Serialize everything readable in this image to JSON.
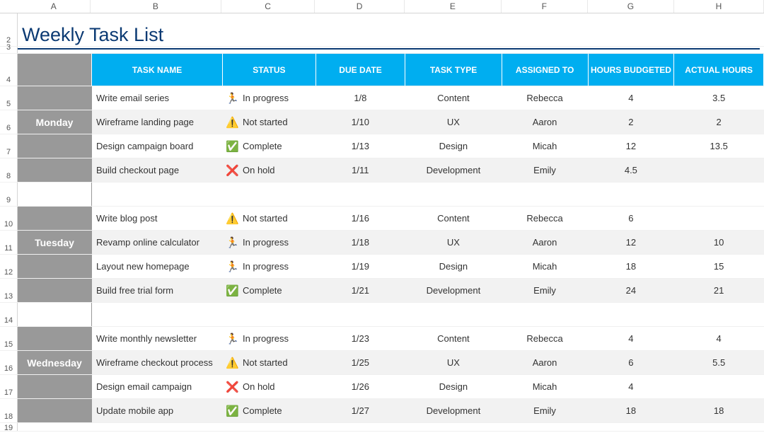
{
  "title": "Weekly Task List",
  "columns": [
    "A",
    "B",
    "C",
    "D",
    "E",
    "F",
    "G",
    "H"
  ],
  "row_numbers": [
    "2",
    "3",
    "4",
    "5",
    "6",
    "7",
    "8",
    "9",
    "10",
    "11",
    "12",
    "13",
    "14",
    "15",
    "16",
    "17",
    "18",
    "19"
  ],
  "headers": {
    "task_name": "TASK NAME",
    "status": "STATUS",
    "due_date": "DUE DATE",
    "task_type": "TASK TYPE",
    "assigned_to": "ASSIGNED TO",
    "hours_budgeted": "HOURS BUDGETED",
    "actual_hours": "ACTUAL HOURS"
  },
  "status_icons": {
    "In progress": "ico-progress",
    "Not started": "ico-notstarted",
    "Complete": "ico-complete",
    "On hold": "ico-onhold"
  },
  "days": [
    {
      "name": "Monday",
      "tasks": [
        {
          "name": "Write email series",
          "status": "In progress",
          "due": "1/8",
          "type": "Content",
          "assigned": "Rebecca",
          "budget": "4",
          "actual": "3.5"
        },
        {
          "name": "Wireframe landing page",
          "status": "Not started",
          "due": "1/10",
          "type": "UX",
          "assigned": "Aaron",
          "budget": "2",
          "actual": "2"
        },
        {
          "name": "Design campaign board",
          "status": "Complete",
          "due": "1/13",
          "type": "Design",
          "assigned": "Micah",
          "budget": "12",
          "actual": "13.5"
        },
        {
          "name": "Build checkout page",
          "status": "On hold",
          "due": "1/11",
          "type": "Development",
          "assigned": "Emily",
          "budget": "4.5",
          "actual": ""
        }
      ]
    },
    {
      "name": "Tuesday",
      "tasks": [
        {
          "name": "Write blog post",
          "status": "Not started",
          "due": "1/16",
          "type": "Content",
          "assigned": "Rebecca",
          "budget": "6",
          "actual": ""
        },
        {
          "name": "Revamp online calculator",
          "status": "In progress",
          "due": "1/18",
          "type": "UX",
          "assigned": "Aaron",
          "budget": "12",
          "actual": "10"
        },
        {
          "name": "Layout new homepage",
          "status": "In progress",
          "due": "1/19",
          "type": "Design",
          "assigned": "Micah",
          "budget": "18",
          "actual": "15"
        },
        {
          "name": "Build free trial form",
          "status": "Complete",
          "due": "1/21",
          "type": "Development",
          "assigned": "Emily",
          "budget": "24",
          "actual": "21"
        }
      ]
    },
    {
      "name": "Wednesday",
      "tasks": [
        {
          "name": "Write monthly newsletter",
          "status": "In progress",
          "due": "1/23",
          "type": "Content",
          "assigned": "Rebecca",
          "budget": "4",
          "actual": "4"
        },
        {
          "name": "Wireframe checkout process",
          "status": "Not started",
          "due": "1/25",
          "type": "UX",
          "assigned": "Aaron",
          "budget": "6",
          "actual": "5.5"
        },
        {
          "name": "Design email campaign",
          "status": "On hold",
          "due": "1/26",
          "type": "Design",
          "assigned": "Micah",
          "budget": "4",
          "actual": ""
        },
        {
          "name": "Update mobile app",
          "status": "Complete",
          "due": "1/27",
          "type": "Development",
          "assigned": "Emily",
          "budget": "18",
          "actual": "18"
        }
      ]
    }
  ]
}
